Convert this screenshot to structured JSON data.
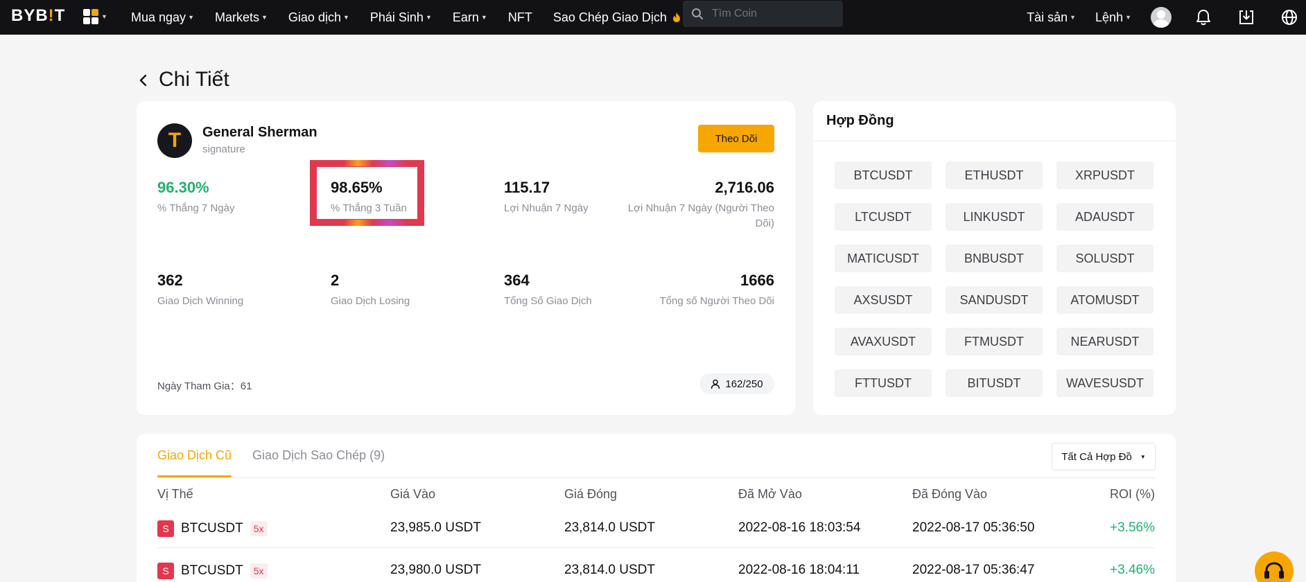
{
  "nav": {
    "logo_prefix": "BYB",
    "logo_bang": "!",
    "logo_suffix": "T",
    "items": [
      {
        "label": "Mua ngay",
        "caret": true
      },
      {
        "label": "Markets",
        "caret": true
      },
      {
        "label": "Giao dịch",
        "caret": true
      },
      {
        "label": "Phái Sinh",
        "caret": true
      },
      {
        "label": "Earn",
        "caret": true
      },
      {
        "label": "NFT",
        "caret": false
      },
      {
        "label": "Sao Chép Giao Dịch",
        "caret": false
      }
    ],
    "search_placeholder": "Tìm Coin",
    "assets_label": "Tài sản",
    "orders_label": "Lệnh",
    "accent": "#f7a600"
  },
  "page": {
    "title": "Chi Tiết"
  },
  "trader": {
    "avatar_letter": "T",
    "name": "General Sherman",
    "subtitle": "signature",
    "follow_label": "Theo Dõi",
    "stats": [
      {
        "value": "96.30%",
        "label": "% Thắng 7 Ngày"
      },
      {
        "value": "98.65%",
        "label": "% Thắng 3 Tuần"
      },
      {
        "value": "115.17",
        "label": "Lợi Nhuận 7 Ngày"
      },
      {
        "value": "2,716.06",
        "label": "Lợi Nhuận 7 Ngày (Người Theo Dõi)"
      },
      {
        "value": "362",
        "label": "Giao Dịch Winning"
      },
      {
        "value": "2",
        "label": "Giao Dịch Losing"
      },
      {
        "value": "364",
        "label": "Tổng Số Giao Dịch"
      },
      {
        "value": "1666",
        "label": "Tổng số Người Theo Dõi"
      }
    ],
    "join_label": "Ngày Tham Gia：",
    "join_value": "61",
    "followers_capacity": "162/250"
  },
  "contracts": {
    "title": "Hợp Đồng",
    "items": [
      "BTCUSDT",
      "ETHUSDT",
      "XRPUSDT",
      "LTCUSDT",
      "LINKUSDT",
      "ADAUSDT",
      "MATICUSDT",
      "BNBUSDT",
      "SOLUSDT",
      "AXSUSDT",
      "SANDUSDT",
      "ATOMUSDT",
      "AVAXUSDT",
      "FTMUSDT",
      "NEARUSDT",
      "FTTUSDT",
      "BITUSDT",
      "WAVESUSDT"
    ]
  },
  "history": {
    "tabs": [
      "Giao Dịch Cũ",
      "Giao Dịch Sao Chép (9)"
    ],
    "filter_label": "Tất Cả Hợp Đồ",
    "columns": [
      "Vị Thế",
      "Giá Vào",
      "Giá Đóng",
      "Đã Mở Vào",
      "Đã Đóng Vào",
      "ROI (%)"
    ],
    "rows": [
      {
        "side": "S",
        "symbol": "BTCUSDT",
        "leverage": "5x",
        "entry": "23,985.0 USDT",
        "close": "23,814.0 USDT",
        "opened": "2022-08-16 18:03:54",
        "closed": "2022-08-17 05:36:50",
        "roi": "+3.56%"
      },
      {
        "side": "S",
        "symbol": "BTCUSDT",
        "leverage": "5x",
        "entry": "23,980.0 USDT",
        "close": "23,814.0 USDT",
        "opened": "2022-08-16 18:04:11",
        "closed": "2022-08-17 05:36:47",
        "roi": "+3.46%"
      }
    ]
  },
  "colors": {
    "short": "#e2384d",
    "profit": "#20b26c",
    "accent": "#f7a600"
  }
}
